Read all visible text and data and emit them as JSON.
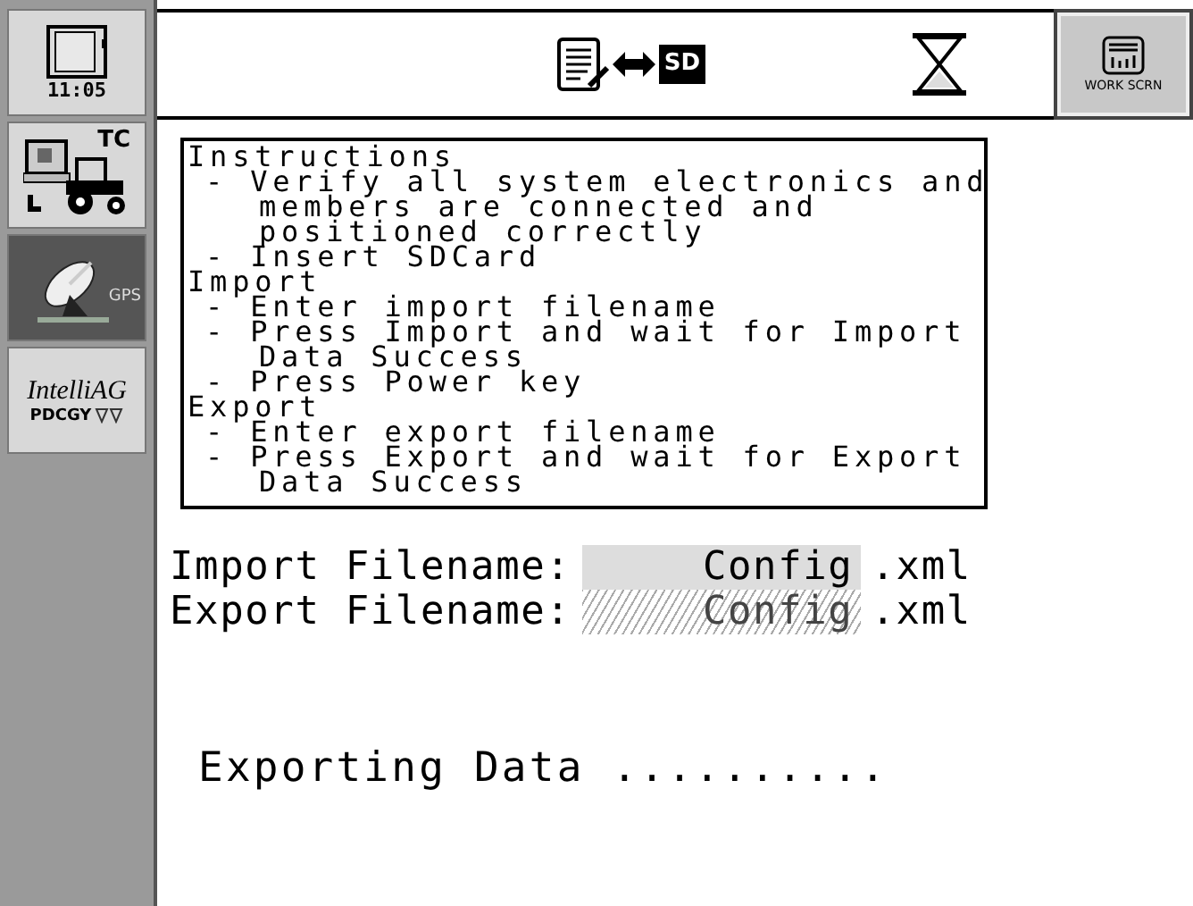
{
  "sidebar": {
    "items": [
      {
        "kind": "clock",
        "label": "11:05",
        "selected": false
      },
      {
        "kind": "task",
        "label": "TC",
        "selected": false
      },
      {
        "kind": "gps",
        "label": "GPS",
        "selected": true
      },
      {
        "kind": "brand",
        "label": "IntelliAG",
        "sublabel": "PDCGY",
        "selected": false
      }
    ]
  },
  "header": {
    "sd_label": "SD",
    "button": "WORK SCRN"
  },
  "instructions": {
    "title": "Instructions",
    "lines": [
      {
        "kind": "bullet",
        "text": "- Verify all system electronics and"
      },
      {
        "kind": "cont",
        "text": "members are connected and"
      },
      {
        "kind": "cont",
        "text": "positioned correctly"
      },
      {
        "kind": "bullet",
        "text": "- Insert SDCard"
      },
      {
        "kind": "heading",
        "text": "Import"
      },
      {
        "kind": "bullet",
        "text": "- Enter import filename"
      },
      {
        "kind": "bullet",
        "text": "- Press Import and wait for Import"
      },
      {
        "kind": "cont",
        "text": "Data Success"
      },
      {
        "kind": "bullet",
        "text": "- Press Power key"
      },
      {
        "kind": "heading",
        "text": "Export"
      },
      {
        "kind": "bullet",
        "text": "- Enter export filename"
      },
      {
        "kind": "bullet",
        "text": "- Press Export and wait for Export"
      },
      {
        "kind": "cont",
        "text": "Data Success"
      }
    ]
  },
  "fields": [
    {
      "label": "Import Filename:",
      "value": "Config",
      "suffix": ".xml",
      "disabled": false
    },
    {
      "label": "Export Filename:",
      "value": "Config",
      "suffix": ".xml",
      "disabled": true
    }
  ],
  "status": "Exporting Data .........."
}
